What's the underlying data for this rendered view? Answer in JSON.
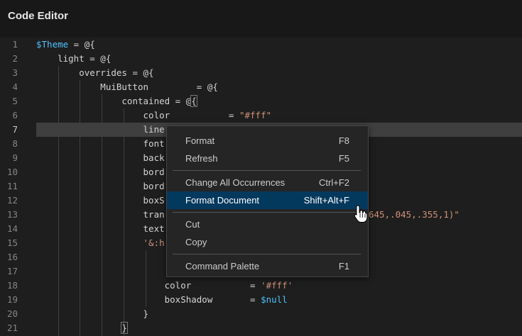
{
  "window": {
    "title": "Code Editor"
  },
  "editor": {
    "current_line": 7,
    "lines": [
      {
        "n": "1",
        "tokens": [
          {
            "t": "$Theme",
            "c": "var"
          },
          {
            "t": " = @{",
            "c": "plain"
          }
        ]
      },
      {
        "n": "2",
        "tokens": [
          {
            "t": "    light = @{",
            "c": "plain"
          }
        ]
      },
      {
        "n": "3",
        "tokens": [
          {
            "t": "        overrides = @{",
            "c": "plain"
          }
        ]
      },
      {
        "n": "4",
        "tokens": [
          {
            "t": "            MuiButton         = @{",
            "c": "plain"
          }
        ]
      },
      {
        "n": "5",
        "tokens": [
          {
            "t": "                contained = @",
            "c": "plain"
          },
          {
            "t": "{",
            "c": "brace"
          }
        ]
      },
      {
        "n": "6",
        "tokens": [
          {
            "t": "                    color           = ",
            "c": "plain"
          },
          {
            "t": "\"#fff\"",
            "c": "str"
          }
        ]
      },
      {
        "n": "7",
        "tokens": [
          {
            "t": "                    line",
            "c": "plain"
          }
        ]
      },
      {
        "n": "8",
        "tokens": [
          {
            "t": "                    font",
            "c": "plain"
          }
        ]
      },
      {
        "n": "9",
        "tokens": [
          {
            "t": "                    back",
            "c": "plain"
          }
        ]
      },
      {
        "n": "10",
        "tokens": [
          {
            "t": "                    bord",
            "c": "plain"
          }
        ]
      },
      {
        "n": "11",
        "tokens": [
          {
            "t": "                    bord",
            "c": "plain"
          }
        ]
      },
      {
        "n": "12",
        "tokens": [
          {
            "t": "                    boxS",
            "c": "plain"
          }
        ]
      },
      {
        "n": "13",
        "tokens": [
          {
            "t": "                    tran",
            "c": "plain"
          }
        ],
        "tail": "645,.045,.355,1)\""
      },
      {
        "n": "14",
        "tokens": [
          {
            "t": "                    text",
            "c": "plain"
          }
        ]
      },
      {
        "n": "15",
        "tokens": [
          {
            "t": "                    ",
            "c": "plain"
          },
          {
            "t": "'&:h",
            "c": "str"
          }
        ]
      },
      {
        "n": "16",
        "tokens": []
      },
      {
        "n": "17",
        "tokens": []
      },
      {
        "n": "18",
        "tokens": [
          {
            "t": "                        color           = ",
            "c": "plain"
          },
          {
            "t": "'#fff'",
            "c": "str"
          }
        ]
      },
      {
        "n": "19",
        "tokens": [
          {
            "t": "                        boxShadow       = ",
            "c": "plain"
          },
          {
            "t": "$null",
            "c": "var"
          }
        ]
      },
      {
        "n": "20",
        "tokens": [
          {
            "t": "                    }",
            "c": "plain"
          }
        ]
      },
      {
        "n": "21",
        "tokens": [
          {
            "t": "                ",
            "c": "plain"
          },
          {
            "t": "}",
            "c": "brace"
          }
        ]
      }
    ]
  },
  "context_menu": {
    "items": [
      {
        "label": "Format",
        "shortcut": "F8"
      },
      {
        "label": "Refresh",
        "shortcut": "F5"
      },
      {
        "label": "Change All Occurrences",
        "shortcut": "Ctrl+F2"
      },
      {
        "label": "Format Document",
        "shortcut": "Shift+Alt+F",
        "active": true
      },
      {
        "label": "Cut",
        "shortcut": ""
      },
      {
        "label": "Copy",
        "shortcut": ""
      },
      {
        "label": "Command Palette",
        "shortcut": "F1"
      }
    ]
  },
  "colors": {
    "background": "#1e1e1e",
    "menu_active": "#04395e",
    "string": "#ce9178",
    "variable": "#4fc1ff"
  }
}
